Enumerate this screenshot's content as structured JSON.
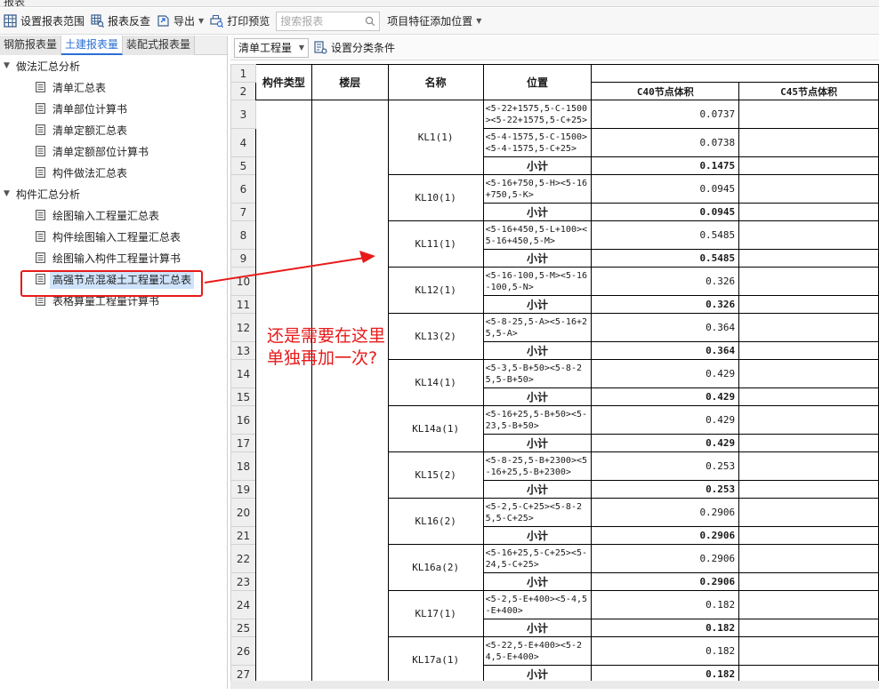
{
  "window": {
    "title": "报表"
  },
  "toolbar": {
    "set_range": "设置报表范围",
    "reverse_check": "报表反查",
    "export": "导出",
    "print_preview": "打印预览",
    "search_placeholder": "搜索报表",
    "feature_position": "项目特征添加位置"
  },
  "tabs": [
    {
      "label": "钢筋报表量",
      "active": false
    },
    {
      "label": "土建报表量",
      "active": true
    },
    {
      "label": "装配式报表量",
      "active": false
    }
  ],
  "tree": {
    "group1": "做法汇总分析",
    "group1_items": [
      "清单汇总表",
      "清单部位计算书",
      "清单定额汇总表",
      "清单定额部位计算书",
      "构件做法汇总表"
    ],
    "group2": "构件汇总分析",
    "group2_items": [
      "绘图输入工程量汇总表",
      "构件绘图输入工程量汇总表",
      "绘图输入构件工程量计算书",
      "高强节点混凝土工程量汇总表",
      "表格算量工程量计算书"
    ],
    "selected": "高强节点混凝土工程量汇总表"
  },
  "right_toolbar": {
    "select_value": "清单工程量",
    "classify_label": "设置分类条件"
  },
  "table": {
    "headers": {
      "type": "构件类型",
      "floor": "楼层",
      "name": "名称",
      "position": "位置",
      "c40": "C40节点体积",
      "c45": "C45节点体积"
    },
    "row_numbers": [
      "1",
      "2",
      "3",
      "4",
      "5",
      "6",
      "7",
      "8",
      "9",
      "10",
      "11",
      "12",
      "13",
      "14",
      "15",
      "16",
      "17",
      "18",
      "19",
      "20",
      "21",
      "22",
      "23",
      "24",
      "25",
      "26",
      "27"
    ],
    "subtotal_label": "小计",
    "groups": [
      {
        "name": "KL1(1)",
        "rows": [
          {
            "pos": "<5-22+1575,5-C-1500><5-22+1575,5-C+25>",
            "c40": "0.0737"
          },
          {
            "pos": "<5-4-1575,5-C-1500><5-4-1575,5-C+25>",
            "c40": "0.0738"
          }
        ],
        "subtotal": "0.1475"
      },
      {
        "name": "KL10(1)",
        "rows": [
          {
            "pos": "<5-16+750,5-H><5-16+750,5-K>",
            "c40": "0.0945"
          }
        ],
        "subtotal": "0.0945"
      },
      {
        "name": "KL11(1)",
        "rows": [
          {
            "pos": "<5-16+450,5-L+100><5-16+450,5-M>",
            "c40": "0.5485"
          }
        ],
        "subtotal": "0.5485"
      },
      {
        "name": "KL12(1)",
        "rows": [
          {
            "pos": "<5-16-100,5-M><5-16-100,5-N>",
            "c40": "0.326"
          }
        ],
        "subtotal": "0.326"
      },
      {
        "name": "KL13(2)",
        "rows": [
          {
            "pos": "<5-8-25,5-A><5-16+25,5-A>",
            "c40": "0.364"
          }
        ],
        "subtotal": "0.364"
      },
      {
        "name": "KL14(1)",
        "rows": [
          {
            "pos": "<5-3,5-B+50><5-8-25,5-B+50>",
            "c40": "0.429"
          }
        ],
        "subtotal": "0.429"
      },
      {
        "name": "KL14a(1)",
        "rows": [
          {
            "pos": "<5-16+25,5-B+50><5-23,5-B+50>",
            "c40": "0.429"
          }
        ],
        "subtotal": "0.429"
      },
      {
        "name": "KL15(2)",
        "rows": [
          {
            "pos": "<5-8-25,5-B+2300><5-16+25,5-B+2300>",
            "c40": "0.253"
          }
        ],
        "subtotal": "0.253"
      },
      {
        "name": "KL16(2)",
        "rows": [
          {
            "pos": "<5-2,5-C+25><5-8-25,5-C+25>",
            "c40": "0.2906"
          }
        ],
        "subtotal": "0.2906"
      },
      {
        "name": "KL16a(2)",
        "rows": [
          {
            "pos": "<5-16+25,5-C+25><5-24,5-C+25>",
            "c40": "0.2906"
          }
        ],
        "subtotal": "0.2906"
      },
      {
        "name": "KL17(1)",
        "rows": [
          {
            "pos": "<5-2,5-E+400><5-4,5-E+400>",
            "c40": "0.182"
          }
        ],
        "subtotal": "0.182"
      },
      {
        "name": "KL17a(1)",
        "rows": [
          {
            "pos": "<5-22,5-E+400><5-24,5-E+400>",
            "c40": "0.182"
          }
        ],
        "subtotal": "0.182"
      }
    ]
  },
  "annotation": {
    "line1": "还是需要在这里",
    "line2": "单独再加一次?",
    "color": "#e81a1a"
  }
}
